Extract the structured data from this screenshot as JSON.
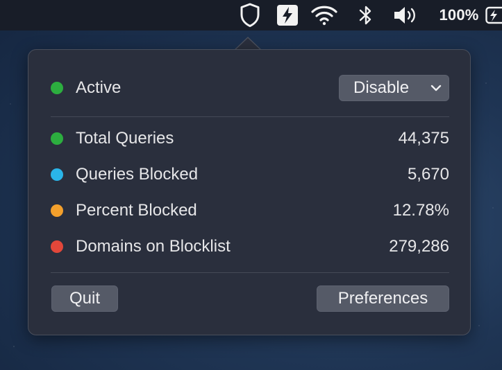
{
  "menubar": {
    "battery_text": "100%"
  },
  "status": {
    "label": "Active",
    "color": "#2cae3f",
    "toggle_value": "Disable"
  },
  "stats": [
    {
      "label": "Total Queries",
      "value": "44,375",
      "color": "#2cae3f"
    },
    {
      "label": "Queries Blocked",
      "value": "5,670",
      "color": "#2ab5e9"
    },
    {
      "label": "Percent Blocked",
      "value": "12.78%",
      "color": "#f3a02c"
    },
    {
      "label": "Domains on Blocklist",
      "value": "279,286",
      "color": "#e2473a"
    }
  ],
  "actions": {
    "quit_label": "Quit",
    "preferences_label": "Preferences"
  }
}
